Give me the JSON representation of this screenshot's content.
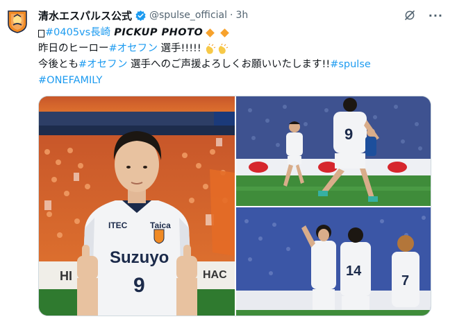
{
  "account": {
    "display_name": "清水エスパルス公式",
    "handle": "@spulse_official",
    "separator": "·",
    "time": "3h",
    "avatar_icon": "club-crest-icon",
    "verified_icon": "verified-badge-icon"
  },
  "actions": {
    "grok_icon": "grok-icon",
    "more_label": "···"
  },
  "tweet": {
    "line1": {
      "hashtag": "#0405vs長崎",
      "pickup": "PICKUP PHOTO"
    },
    "line2": {
      "text_before": "昨日のヒーロー ",
      "hashtag": "#オセフン",
      "text_after": " 選手!!!!! "
    },
    "line3": {
      "text_before": "今後とも ",
      "hashtag": "#オセフン",
      "text_after": " 選手へのご声援よろしくお願いいたします!!",
      "hashtag2": "#spulse"
    },
    "line4": {
      "hashtag": "#ONEFAMILY"
    }
  },
  "photos": {
    "p1": {
      "sponsor_left": "ITEC",
      "sponsor_right": "Taica",
      "main_sponsor": "Suzuyo",
      "number": "9",
      "board_text": "HI",
      "board_text2": "HAC"
    },
    "p2": {
      "number": "9"
    },
    "p3": {
      "number": "14",
      "number2": "7"
    }
  },
  "colors": {
    "link": "#1d9bf0",
    "text": "#0f1419",
    "muted": "#536471",
    "verified": "#1d9bf0",
    "accent_orange": "#f7a22c"
  }
}
